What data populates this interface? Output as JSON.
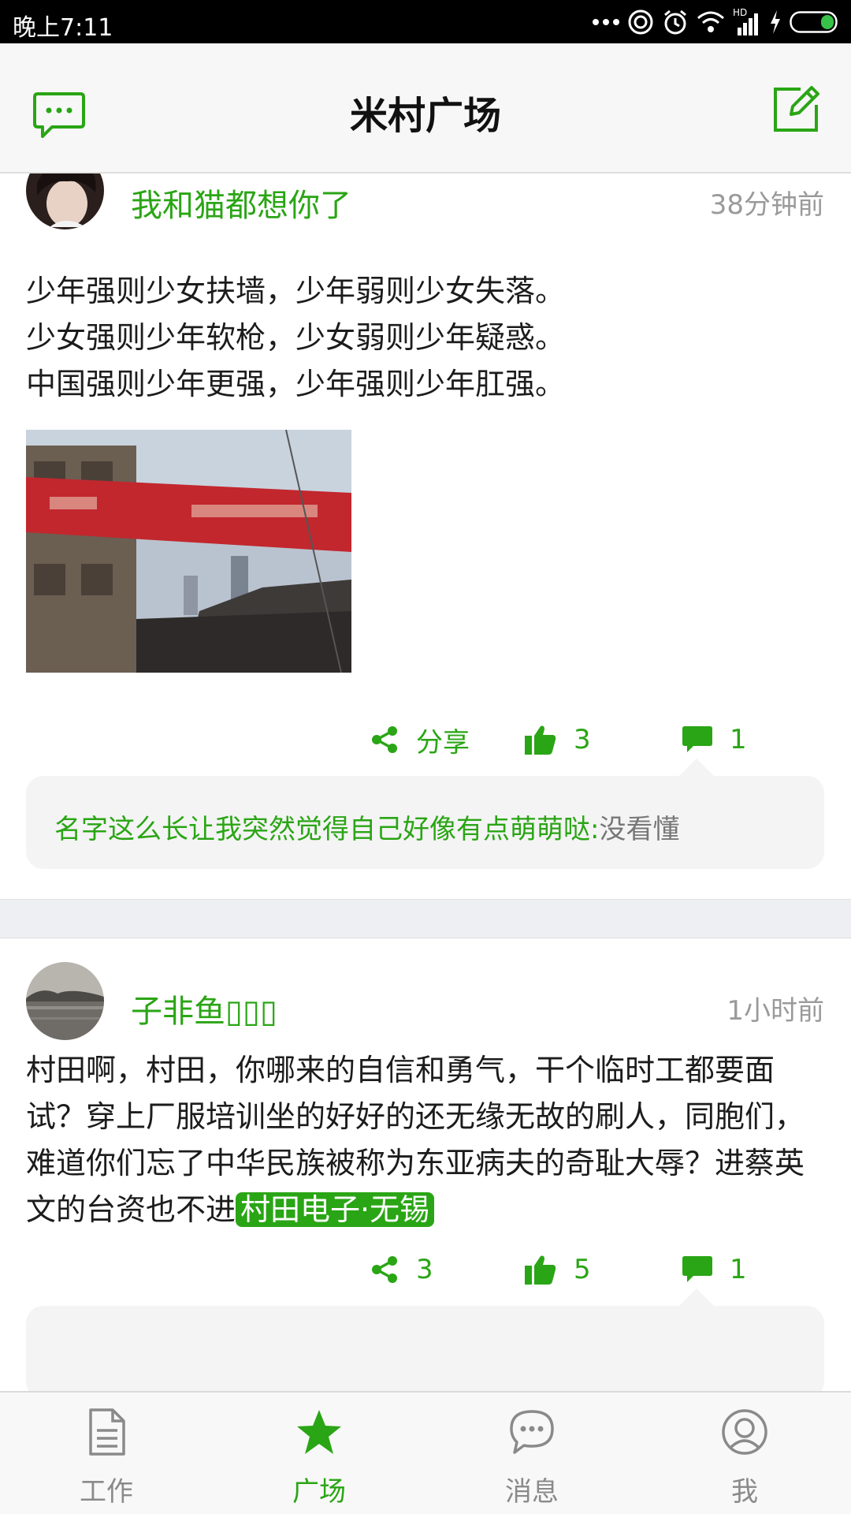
{
  "status_bar": {
    "time": "晚上7:11",
    "network_label": "HD"
  },
  "header": {
    "title": "米村广场",
    "left_icon": "chat-bubble-icon",
    "right_icon": "edit-icon"
  },
  "posts": [
    {
      "username": "我和猫都想你了",
      "time": "38分钟前",
      "content": "少年强则少女扶墙，少年弱则少女失落。\n少女强则少年软枪，少女弱则少年疑惑。\n中国强则少年更强，少年强则少年肛强。",
      "share_label": "分享",
      "likes": "3",
      "comments": "1",
      "comment": {
        "author": "名字这么长让我突然觉得自己好像有点萌萌哒:",
        "text": "没看懂"
      }
    },
    {
      "username": "子非鱼▯▯▯",
      "time": "1小时前",
      "content": "村田啊，村田，你哪来的自信和勇气，干个临时工都要面试？穿上厂服培训坐的好好的还无缘无故的刷人，同胞们，难道你们忘了中华民族被称为东亚病夫的奇耻大辱？进蔡英文的台资也不进",
      "tag": "村田电子·无锡",
      "share_count": "3",
      "likes": "5",
      "comments": "1"
    }
  ],
  "bottom_nav": [
    {
      "label": "工作",
      "icon": "document-icon",
      "active": false
    },
    {
      "label": "广场",
      "icon": "star-icon",
      "active": true
    },
    {
      "label": "消息",
      "icon": "message-bubble-icon",
      "active": false
    },
    {
      "label": "我",
      "icon": "profile-icon",
      "active": false
    }
  ],
  "colors": {
    "accent": "#2aa515",
    "status_bar": "#000000",
    "header_bg": "#f7f7f7",
    "muted_text": "#9a9a9a"
  }
}
